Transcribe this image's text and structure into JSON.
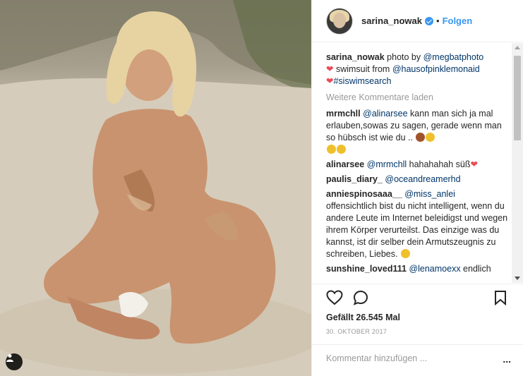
{
  "post": {
    "username": "sarina_nowak",
    "follow_label": "Folgen",
    "separator": "•"
  },
  "caption": {
    "user": "sarina_nowak",
    "text1": " photo by ",
    "mention1": "@megbatphoto",
    "heart": "❤",
    "text2": " swimsuit from ",
    "mention2": "@hausofpinklemonaid",
    "hashtag": "#siswimsearch"
  },
  "load_more": "Weitere Kommentare laden",
  "comments": [
    {
      "user": "mrmchll",
      "mention": "@alinarsee",
      "text": " kann man sich ja mal erlauben,sowas zu sagen, gerade wenn man so hübsch ist wie du .."
    },
    {
      "user": "alinarsee",
      "mention": "@mrmchll",
      "text": " hahahahah süß"
    },
    {
      "user": "paulis_diary_",
      "mention": "@oceandreamerhd",
      "text": ""
    },
    {
      "user": "anniespinosaaa__",
      "mention": "@miss_anlei",
      "text": " offensichtlich bist du nicht intelligent, wenn du andere Leute im Internet beleidigst und wegen ihrem Körper verurteilst. Das einzige was du kannst, ist dir selber dein Armutszeugnis zu schreiben, Liebes."
    },
    {
      "user": "sunshine_loved111",
      "mention": "@lenamoexx",
      "text": " endlich"
    }
  ],
  "likes": "Gefällt 26.545 Mal",
  "date": "30. OKTOBER 2017",
  "add_comment_placeholder": "Kommentar hinzufügen ...",
  "options_label": "...",
  "icons": {
    "like": "heart-outline-icon",
    "comment": "speech-bubble-icon",
    "save": "bookmark-icon",
    "user_tag": "person-icon"
  },
  "colors": {
    "link": "#003569",
    "follow": "#3897f0",
    "heart": "#ed4956"
  }
}
